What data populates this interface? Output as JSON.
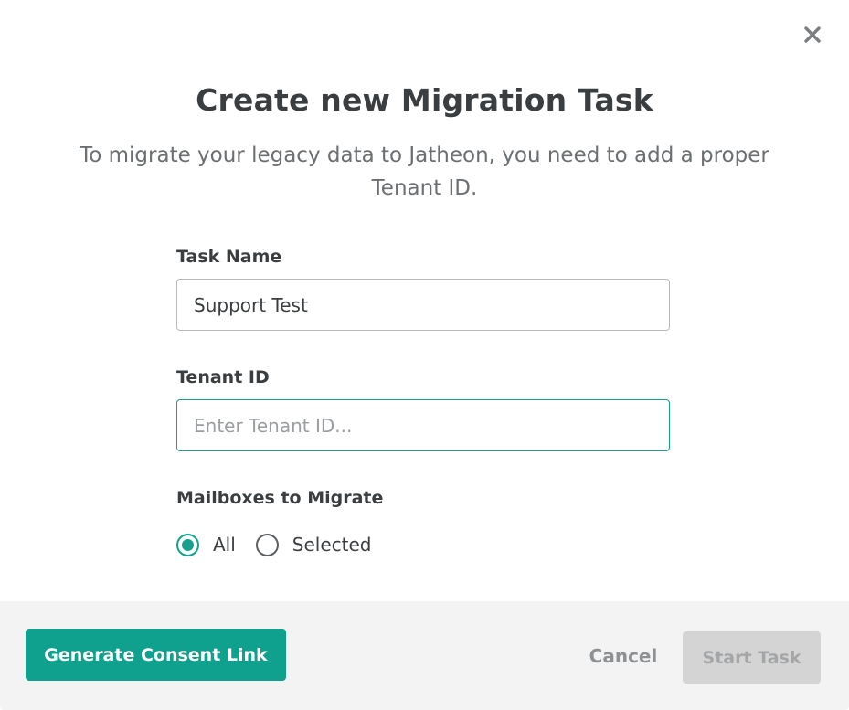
{
  "dialog": {
    "title": "Create new Migration Task",
    "subtitle": "To migrate your legacy data to Jatheon, you need to add a proper Tenant ID.",
    "close_icon": "close-icon"
  },
  "form": {
    "task_name": {
      "label": "Task Name",
      "value": "Support Test"
    },
    "tenant_id": {
      "label": "Tenant ID",
      "value": "",
      "placeholder": "Enter Tenant ID..."
    },
    "mailboxes": {
      "label": "Mailboxes to Migrate",
      "options": [
        {
          "label": "All",
          "checked": true
        },
        {
          "label": "Selected",
          "checked": false
        }
      ]
    }
  },
  "footer": {
    "consent_label": "Generate Consent Link",
    "cancel_label": "Cancel",
    "start_label": "Start Task"
  },
  "colors": {
    "accent": "#10a18e",
    "title": "#3b3e40",
    "footer_bg": "#f3f3f3",
    "disabled_button": "#d4d4d4"
  }
}
